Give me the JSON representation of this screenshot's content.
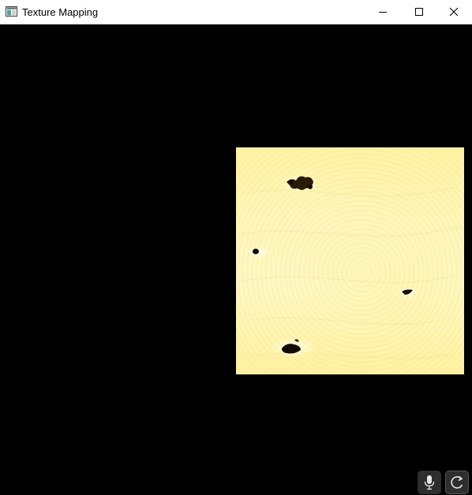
{
  "window": {
    "title": "Texture Mapping",
    "icon": "app-window-icon",
    "controls": [
      "minimize-icon",
      "maximize-icon",
      "close-icon"
    ]
  },
  "scene": {
    "background": "#000000",
    "texture": {
      "description_icon": "sun-texture",
      "base_color": "#fff5b0",
      "spot_color": "#1a0f05"
    }
  },
  "overlay_buttons": [
    "microphone-icon",
    "rotate-icon"
  ]
}
